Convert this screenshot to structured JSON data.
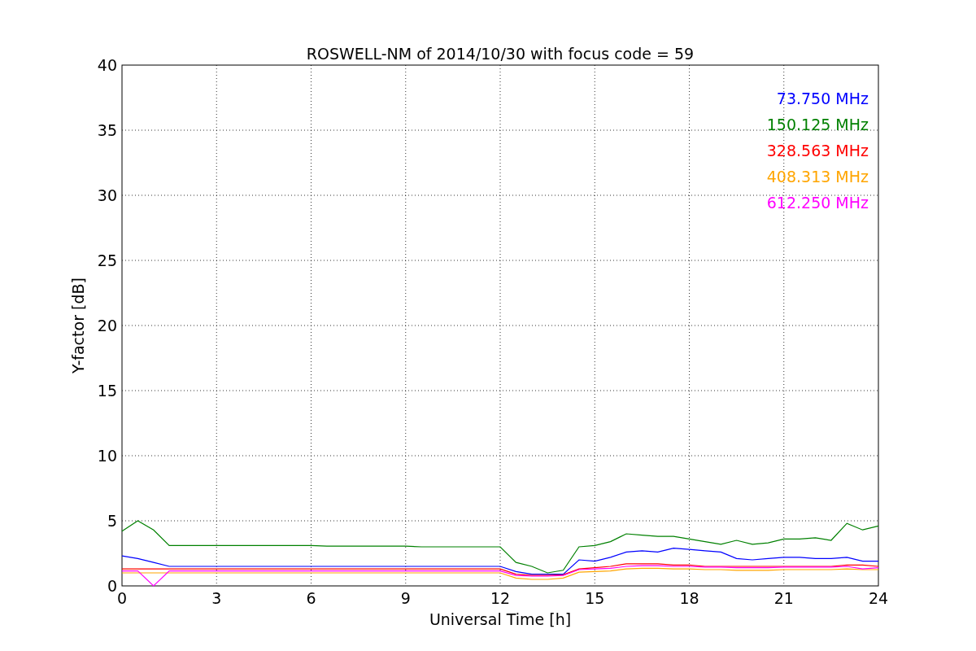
{
  "chart_data": {
    "type": "line",
    "title": "ROSWELL-NM of 2014/10/30 with focus code = 59",
    "xlabel": "Universal Time [h]",
    "ylabel": "Y-factor [dB]",
    "x": [
      0,
      0.5,
      1,
      1.5,
      2,
      2.5,
      3,
      3.5,
      4,
      4.5,
      5,
      5.5,
      6,
      6.5,
      7,
      7.5,
      8,
      8.5,
      9,
      9.5,
      10,
      10.5,
      11,
      11.5,
      12,
      12.5,
      13,
      13.5,
      14,
      14.5,
      15,
      15.5,
      16,
      16.5,
      17,
      17.5,
      18,
      18.5,
      19,
      19.5,
      20,
      20.5,
      21,
      21.5,
      22,
      22.5,
      23,
      23.5,
      24
    ],
    "series": [
      {
        "name": "73.750 MHz",
        "color": "#0000ff",
        "values": [
          2.3,
          2.1,
          1.8,
          1.5,
          1.5,
          1.5,
          1.5,
          1.5,
          1.5,
          1.5,
          1.5,
          1.5,
          1.5,
          1.5,
          1.5,
          1.5,
          1.5,
          1.5,
          1.5,
          1.5,
          1.5,
          1.5,
          1.5,
          1.5,
          1.5,
          1.1,
          0.9,
          0.9,
          0.9,
          2.0,
          1.9,
          2.2,
          2.6,
          2.7,
          2.6,
          2.9,
          2.8,
          2.7,
          2.6,
          2.1,
          2.0,
          2.1,
          2.2,
          2.2,
          2.1,
          2.1,
          2.2,
          1.9,
          1.9
        ]
      },
      {
        "name": "150.125 MHz",
        "color": "#008000",
        "values": [
          4.2,
          5.0,
          4.3,
          3.1,
          3.1,
          3.1,
          3.1,
          3.1,
          3.1,
          3.1,
          3.1,
          3.1,
          3.1,
          3.05,
          3.05,
          3.05,
          3.05,
          3.05,
          3.05,
          3.0,
          3.0,
          3.0,
          3.0,
          3.0,
          3.0,
          1.8,
          1.5,
          1.0,
          1.2,
          3.0,
          3.1,
          3.4,
          4.0,
          3.9,
          3.8,
          3.8,
          3.6,
          3.4,
          3.2,
          3.5,
          3.2,
          3.3,
          3.6,
          3.6,
          3.7,
          3.5,
          4.8,
          4.3,
          4.6
        ]
      },
      {
        "name": "328.563 MHz",
        "color": "#ff0000",
        "values": [
          1.3,
          1.3,
          1.3,
          1.3,
          1.3,
          1.3,
          1.3,
          1.3,
          1.3,
          1.3,
          1.3,
          1.3,
          1.3,
          1.3,
          1.3,
          1.3,
          1.3,
          1.3,
          1.3,
          1.3,
          1.3,
          1.3,
          1.3,
          1.3,
          1.3,
          0.9,
          0.8,
          0.8,
          0.85,
          1.3,
          1.4,
          1.5,
          1.7,
          1.7,
          1.7,
          1.6,
          1.6,
          1.5,
          1.5,
          1.5,
          1.5,
          1.5,
          1.5,
          1.5,
          1.5,
          1.5,
          1.6,
          1.6,
          1.5
        ]
      },
      {
        "name": "408.313 MHz",
        "color": "#ffa500",
        "values": [
          1.0,
          1.0,
          1.0,
          1.0,
          1.0,
          1.0,
          1.0,
          1.0,
          1.0,
          1.0,
          1.0,
          1.0,
          1.0,
          1.0,
          1.0,
          1.0,
          1.0,
          1.0,
          1.0,
          1.0,
          1.0,
          1.0,
          1.0,
          1.0,
          1.0,
          0.6,
          0.5,
          0.5,
          0.6,
          1.05,
          1.1,
          1.15,
          1.3,
          1.35,
          1.35,
          1.3,
          1.3,
          1.25,
          1.25,
          1.2,
          1.2,
          1.2,
          1.25,
          1.25,
          1.25,
          1.25,
          1.3,
          1.25,
          1.25
        ]
      },
      {
        "name": "612.250 MHz",
        "color": "#ff00ff",
        "values": [
          1.15,
          1.15,
          0.0,
          1.15,
          1.15,
          1.15,
          1.15,
          1.15,
          1.15,
          1.15,
          1.15,
          1.15,
          1.15,
          1.15,
          1.15,
          1.15,
          1.15,
          1.15,
          1.15,
          1.15,
          1.15,
          1.15,
          1.15,
          1.15,
          1.15,
          0.8,
          0.75,
          0.75,
          0.8,
          1.25,
          1.3,
          1.35,
          1.5,
          1.55,
          1.55,
          1.5,
          1.5,
          1.45,
          1.45,
          1.4,
          1.4,
          1.4,
          1.45,
          1.45,
          1.45,
          1.45,
          1.5,
          1.3,
          1.4
        ]
      }
    ],
    "grid": true,
    "xlim": [
      0,
      24
    ],
    "ylim": [
      0,
      40
    ],
    "xticks": [
      0,
      3,
      6,
      9,
      12,
      15,
      18,
      21,
      24
    ],
    "yticks": [
      0,
      5,
      10,
      15,
      20,
      25,
      30,
      35,
      40
    ]
  }
}
